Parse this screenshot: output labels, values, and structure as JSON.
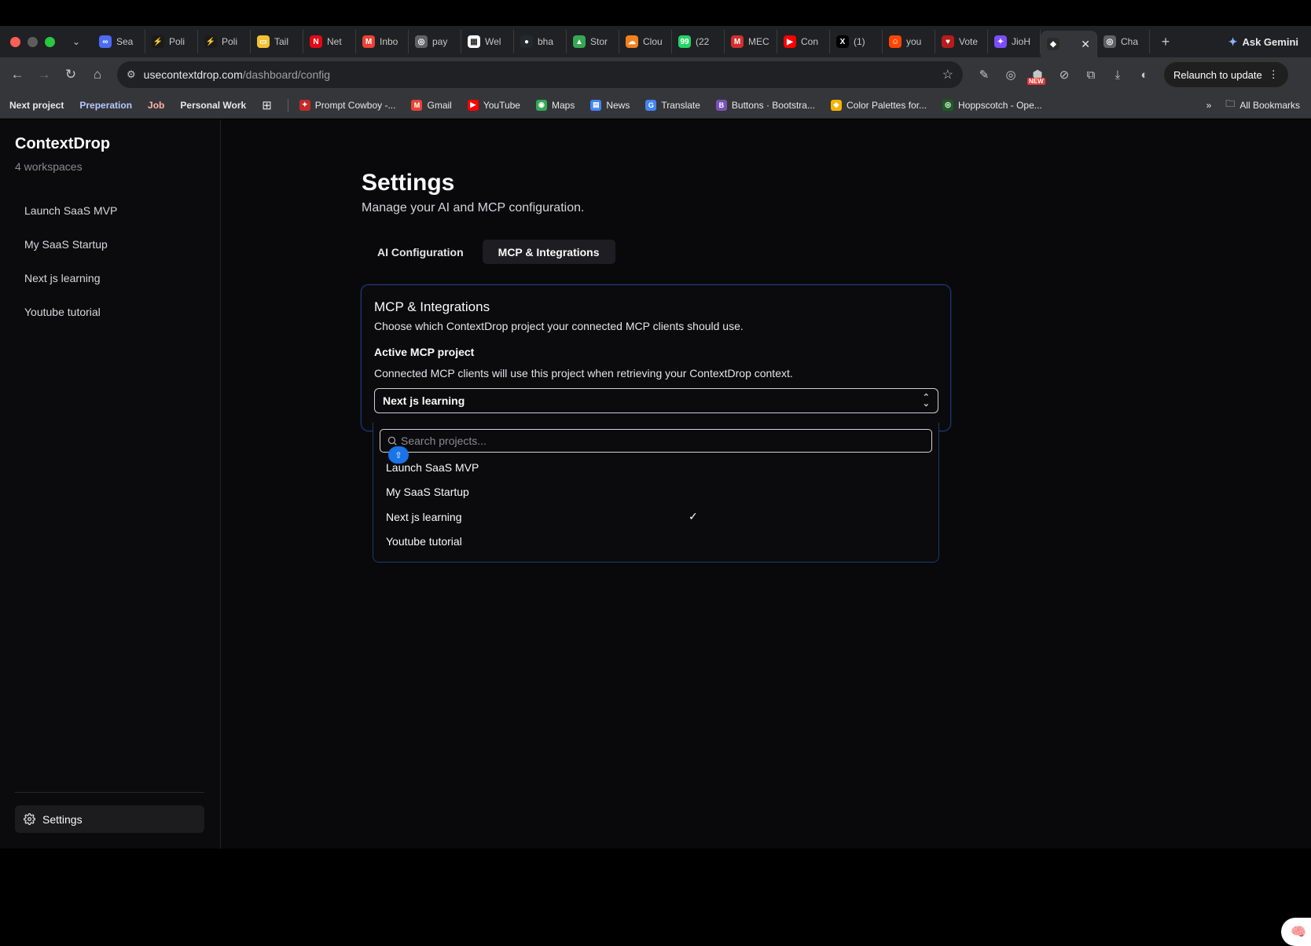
{
  "browser": {
    "tabs": [
      {
        "label": "Sea",
        "color": "#4a6cf7",
        "glyph": "∞"
      },
      {
        "label": "Poli",
        "color": "#1b1b1b",
        "glyph": "⚡"
      },
      {
        "label": "Poli",
        "color": "#1b1b1b",
        "glyph": "⚡"
      },
      {
        "label": "Tail",
        "color": "#f2c230",
        "glyph": "▭"
      },
      {
        "label": "Net",
        "color": "#e50914",
        "glyph": "N"
      },
      {
        "label": "Inbo",
        "color": "#ea4335",
        "glyph": "M"
      },
      {
        "label": "pay",
        "color": "#5f6368",
        "glyph": "◎"
      },
      {
        "label": "Wel",
        "color": "#ffffff",
        "glyph": "▦"
      },
      {
        "label": "bha",
        "color": "#24292f",
        "glyph": "●"
      },
      {
        "label": "Stor",
        "color": "#34a853",
        "glyph": "▲"
      },
      {
        "label": "Clou",
        "color": "#f38020",
        "glyph": "☁"
      },
      {
        "label": "(22",
        "color": "#25d366",
        "glyph": "99"
      },
      {
        "label": "MEC",
        "color": "#d32f2f",
        "glyph": "M"
      },
      {
        "label": "Con",
        "color": "#ff0000",
        "glyph": "▶"
      },
      {
        "label": "(1) ",
        "color": "#000000",
        "glyph": "X"
      },
      {
        "label": "you",
        "color": "#ff4500",
        "glyph": "☺"
      },
      {
        "label": "Vote",
        "color": "#b71c1c",
        "glyph": "♥"
      },
      {
        "label": "JioH",
        "color": "#7c4dff",
        "glyph": "✦"
      }
    ],
    "after_tabs": [
      {
        "label": "Cha",
        "color": "#5f6368",
        "glyph": "◎"
      }
    ],
    "active_tab_close": "✕",
    "new_tab": "+",
    "ask_gemini": "Ask Gemini",
    "url_host": "usecontextdrop.com",
    "url_path": "/dashboard/config",
    "relaunch": "Relaunch to update",
    "new_badge": "NEW"
  },
  "bookmarks": {
    "items": [
      {
        "label": "Next project",
        "style": "strong"
      },
      {
        "label": "Preperation",
        "style": "blue"
      },
      {
        "label": "Job",
        "style": "pink"
      },
      {
        "label": "Personal Work",
        "style": "strong"
      }
    ],
    "links": [
      {
        "label": "Prompt Cowboy -...",
        "color": "#c62828",
        "glyph": "✦"
      },
      {
        "label": "Gmail",
        "color": "#ea4335",
        "glyph": "M"
      },
      {
        "label": "YouTube",
        "color": "#ff0000",
        "glyph": "▶"
      },
      {
        "label": "Maps",
        "color": "#34a853",
        "glyph": "◉"
      },
      {
        "label": "News",
        "color": "#4285f4",
        "glyph": "▤"
      },
      {
        "label": "Translate",
        "color": "#4285f4",
        "glyph": "G"
      },
      {
        "label": "Buttons · Bootstra...",
        "color": "#7952b3",
        "glyph": "B"
      },
      {
        "label": "Color Palettes for...",
        "color": "#f5b400",
        "glyph": "◆"
      },
      {
        "label": "Hoppscotch - Ope...",
        "color": "#1b5e20",
        "glyph": "◎"
      }
    ],
    "all_bookmarks": "All Bookmarks"
  },
  "sidebar": {
    "brand": "ContextDrop",
    "workspace_count": "4 workspaces",
    "items": [
      {
        "label": "Launch SaaS MVP"
      },
      {
        "label": "My SaaS Startup"
      },
      {
        "label": "Next js learning"
      },
      {
        "label": "Youtube tutorial"
      }
    ],
    "settings_label": "Settings"
  },
  "main": {
    "title": "Settings",
    "subtitle": "Manage your AI and MCP configuration.",
    "tabs": [
      {
        "label": "AI Configuration",
        "active": false
      },
      {
        "label": "MCP & Integrations",
        "active": true
      }
    ],
    "card": {
      "title": "MCP & Integrations",
      "description": "Choose which ContextDrop project your connected MCP clients should use.",
      "field_label": "Active MCP project",
      "field_description": "Connected MCP clients will use this project when retrieving your ContextDrop context.",
      "selected_value": "Next js learning"
    },
    "dropdown": {
      "search_placeholder": "Search projects...",
      "options": [
        {
          "label": "Launch SaaS MVP",
          "selected": false
        },
        {
          "label": "My SaaS Startup",
          "selected": false
        },
        {
          "label": "Next js learning",
          "selected": true
        },
        {
          "label": "Youtube tutorial",
          "selected": false
        }
      ],
      "check_glyph": "✓"
    }
  },
  "colors": {
    "accent_border": "#1e3a6b",
    "background": "#09090b"
  }
}
